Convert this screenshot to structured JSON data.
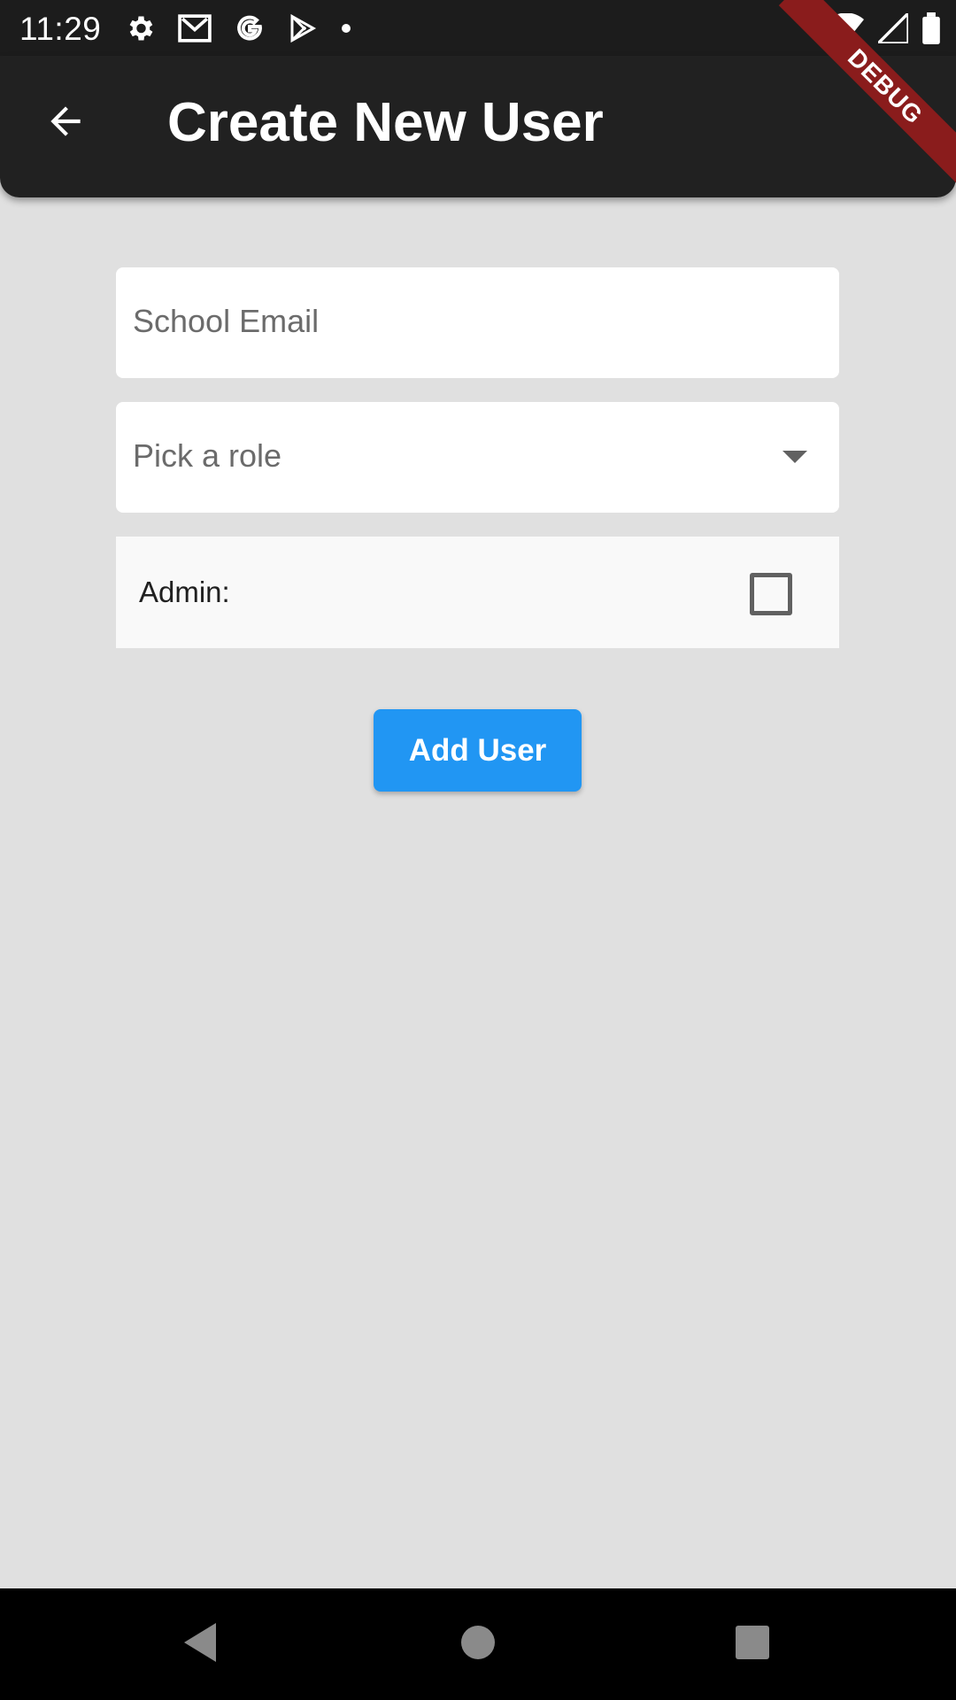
{
  "status_bar": {
    "time": "11:29",
    "icons_left": [
      "settings-icon",
      "gmail-icon",
      "google-icon",
      "play-store-icon",
      "dot-icon"
    ],
    "icons_right": [
      "wifi-icon",
      "signal-icon",
      "battery-icon"
    ]
  },
  "app_bar": {
    "title": "Create New User",
    "back_icon": "arrow-back-icon",
    "background": "#212121"
  },
  "debug_banner": "DEBUG",
  "form": {
    "email": {
      "placeholder": "School Email",
      "value": ""
    },
    "role": {
      "placeholder": "Pick a role",
      "selected": ""
    },
    "admin": {
      "label": "Admin:",
      "checked": false
    },
    "submit_label": "Add User"
  },
  "colors": {
    "accent": "#2196f3",
    "page_background": "#e0e0e0",
    "debug": "#8a1c1c"
  },
  "nav_bar": {
    "buttons": [
      "nav-back-icon",
      "nav-home-icon",
      "nav-recents-icon"
    ]
  }
}
